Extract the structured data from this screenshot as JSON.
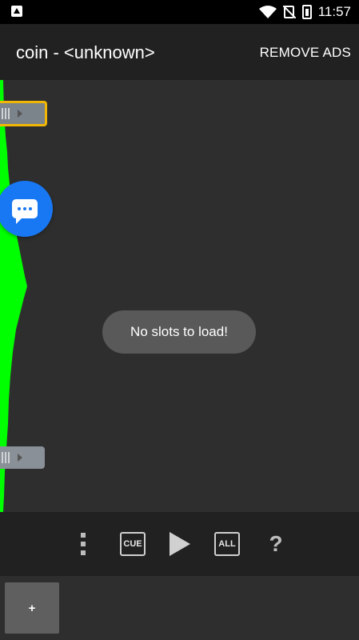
{
  "status_bar": {
    "time": "11:57",
    "icons": [
      "a-notification-icon",
      "wifi-icon",
      "no-sim-icon",
      "battery-charging-icon"
    ]
  },
  "app_bar": {
    "title": "coin - <unknown>",
    "remove_ads_label": "REMOVE ADS"
  },
  "toast": {
    "message": "No slots to load!"
  },
  "controls": {
    "cue_label": "CUE",
    "all_label": "ALL",
    "help_label": "?"
  },
  "bottom": {
    "add_label": "+"
  },
  "colors": {
    "waveform": "#00ff00",
    "handle_highlight": "#f2b705",
    "chat_bubble": "#1877f2"
  }
}
